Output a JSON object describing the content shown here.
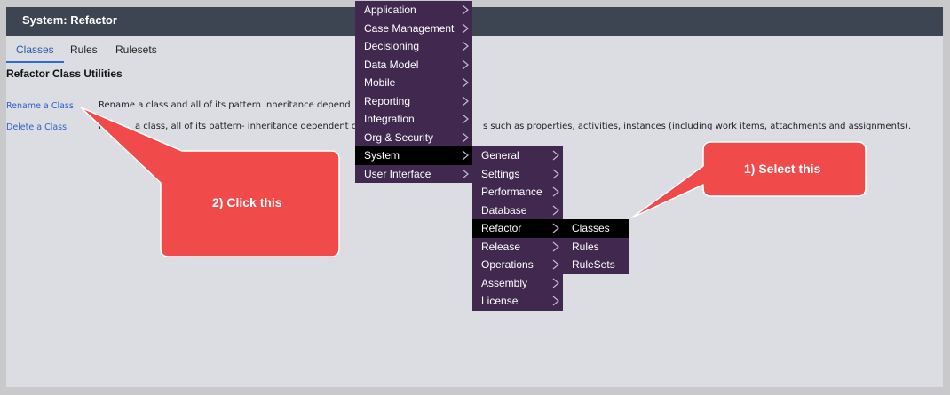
{
  "window": {
    "title": "System: Refactor"
  },
  "tabs": [
    {
      "label": "Classes",
      "active": true
    },
    {
      "label": "Rules",
      "active": false
    },
    {
      "label": "Rulesets",
      "active": false
    }
  ],
  "section_title": "Refactor Class Utilities",
  "utilities": [
    {
      "link": "Rename a Class",
      "description": "Rename a class and all of its pattern inheritance depend"
    },
    {
      "link": "Delete a Class",
      "description_left": "Re",
      "description_mid": "a class, all of its pattern- inheritance dependent cla",
      "description_right": "s such as properties, activities, instances (including work items, attachments and assignments)."
    }
  ],
  "menu_main": [
    {
      "label": "Application",
      "submenu": true
    },
    {
      "label": "Case Management",
      "submenu": true
    },
    {
      "label": "Decisioning",
      "submenu": true
    },
    {
      "label": "Data Model",
      "submenu": true
    },
    {
      "label": "Mobile",
      "submenu": true
    },
    {
      "label": "Reporting",
      "submenu": true
    },
    {
      "label": "Integration",
      "submenu": true
    },
    {
      "label": "Org & Security",
      "submenu": true
    },
    {
      "label": "System",
      "submenu": true,
      "selected": true
    },
    {
      "label": "User Interface",
      "submenu": true
    }
  ],
  "menu_system": [
    {
      "label": "General",
      "submenu": true
    },
    {
      "label": "Settings",
      "submenu": true
    },
    {
      "label": "Performance",
      "submenu": true
    },
    {
      "label": "Database",
      "submenu": true
    },
    {
      "label": "Refactor",
      "submenu": true,
      "selected": true
    },
    {
      "label": "Release",
      "submenu": true
    },
    {
      "label": "Operations",
      "submenu": true
    },
    {
      "label": "Assembly",
      "submenu": true
    },
    {
      "label": "License",
      "submenu": true
    }
  ],
  "menu_refactor": [
    {
      "label": "Classes",
      "selected": true
    },
    {
      "label": "Rules"
    },
    {
      "label": "RuleSets"
    }
  ],
  "callouts": [
    {
      "text": "1) Select this"
    },
    {
      "text": "2) Click this"
    }
  ],
  "colors": {
    "titlebar": "#3d4452",
    "menu_bg": "#40284f",
    "menu_selected": "#000000",
    "callout": "#f04a4a",
    "link": "#3060c8",
    "tab_active_underline": "#2b6bd6"
  }
}
